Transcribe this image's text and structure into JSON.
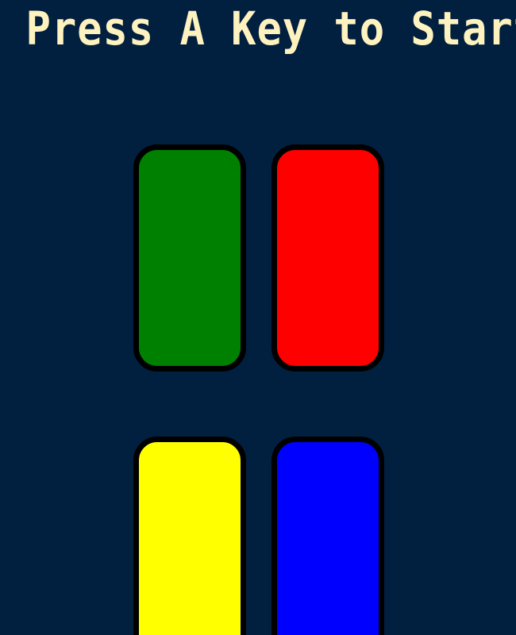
{
  "title": "Press A Key to Start",
  "colors": {
    "background": "#011f3f",
    "title_text": "#fef2bf",
    "button_border": "#000000"
  },
  "buttons": [
    {
      "id": "green",
      "color": "#008000"
    },
    {
      "id": "red",
      "color": "#ff0000"
    },
    {
      "id": "yellow",
      "color": "#ffff00"
    },
    {
      "id": "blue",
      "color": "#0000ff"
    }
  ]
}
